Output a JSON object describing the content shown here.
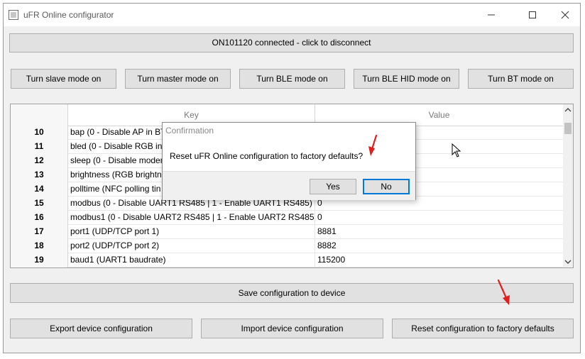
{
  "window": {
    "title": "uFR Online configurator"
  },
  "connection": {
    "label": "ON101120 connected - click to disconnect"
  },
  "mode_buttons": [
    {
      "label": "Turn slave mode on"
    },
    {
      "label": "Turn master mode on"
    },
    {
      "label": "Turn BLE mode on"
    },
    {
      "label": "Turn BLE HID mode on"
    },
    {
      "label": "Turn BT mode on"
    }
  ],
  "table": {
    "headers": {
      "index": "",
      "key": "Key",
      "value": "Value"
    },
    "rows": [
      {
        "index": "10",
        "key": "bap (0 - Disable AP in BT",
        "value": ""
      },
      {
        "index": "11",
        "key": "bled (0 - Disable RGB in B",
        "value": ""
      },
      {
        "index": "12",
        "key": "sleep (0 - Disable modem",
        "value": ""
      },
      {
        "index": "13",
        "key": "brightness (RGB brightne",
        "value": ""
      },
      {
        "index": "14",
        "key": "polltime (NFC polling tin",
        "value": ""
      },
      {
        "index": "15",
        "key": "modbus (0 - Disable UART1 RS485 | 1 - Enable UART1 RS485)",
        "value": "0"
      },
      {
        "index": "16",
        "key": "modbus1 (0 - Disable UART2 RS485 | 1 - Enable UART2 RS485)",
        "value": "0"
      },
      {
        "index": "17",
        "key": "port1 (UDP/TCP port 1)",
        "value": "8881"
      },
      {
        "index": "18",
        "key": "port2 (UDP/TCP port 2)",
        "value": "8882"
      },
      {
        "index": "19",
        "key": "baud1 (UART1 baudrate)",
        "value": "115200"
      }
    ]
  },
  "dialog": {
    "title": "Confirmation",
    "message": "Reset uFR Online configuration to factory defaults?",
    "yes_label": "Yes",
    "no_label": "No"
  },
  "actions": {
    "save_label": "Save configuration to device",
    "export_label": "Export device configuration",
    "import_label": "Import device configuration",
    "reset_label": "Reset configuration to factory defaults"
  },
  "colors": {
    "annotation_arrow": "#e02020",
    "focus_border": "#0078d7"
  }
}
